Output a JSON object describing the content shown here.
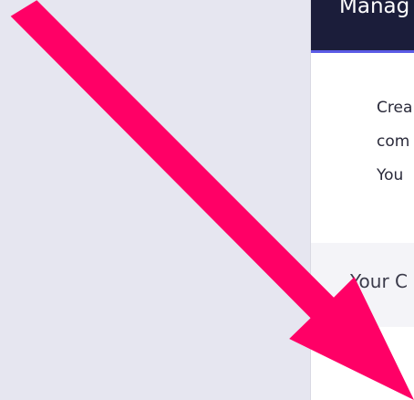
{
  "panel": {
    "title": "Manag",
    "intro_lines": [
      "Crea",
      "com",
      "You"
    ],
    "section_title": "Your C"
  },
  "annotation": {
    "arrow_color": "#ff0066",
    "icon": "diagonal-arrow-down-right"
  },
  "colors": {
    "background": "#e6e6f0",
    "header_bg": "#1b1d3a",
    "header_accent": "#5b5be6",
    "section_bg": "#f4f4f8"
  }
}
